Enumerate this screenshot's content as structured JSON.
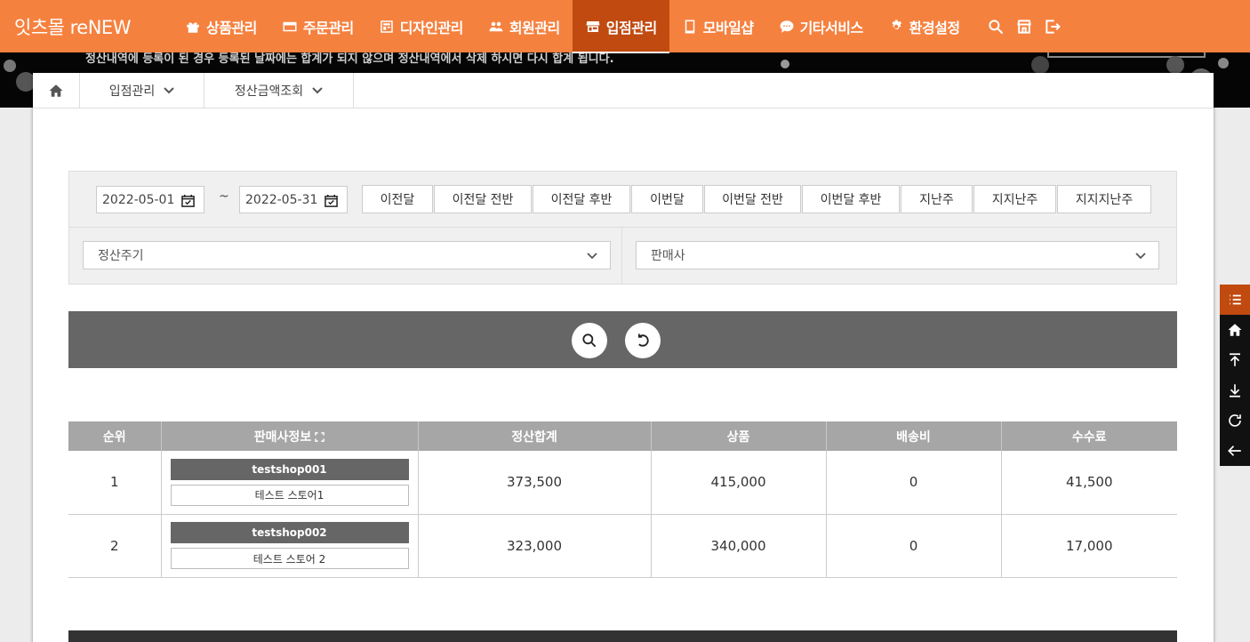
{
  "brand": "잇츠몰 reNEW",
  "nav": [
    {
      "label": "상품관리",
      "icon": "gift-icon"
    },
    {
      "label": "주문관리",
      "icon": "card-icon"
    },
    {
      "label": "디자인관리",
      "icon": "layout-icon"
    },
    {
      "label": "회원관리",
      "icon": "users-icon"
    },
    {
      "label": "입점관리",
      "icon": "store-icon",
      "active": true
    },
    {
      "label": "모바일샵",
      "icon": "tablet-icon"
    },
    {
      "label": "기타서비스",
      "icon": "chat-icon"
    },
    {
      "label": "환경설정",
      "icon": "gear-icon"
    }
  ],
  "notice_text": "정산내역에 등록이 된 경우 등록된 날짜에는 합계가 되지 않으며 정산내역에서 삭제 하시면 다시 합계 됩니다.",
  "breadcrumb": {
    "level1": "입점관리",
    "level2": "정산금액조회"
  },
  "filter": {
    "date_from": "2022-05-01",
    "date_to": "2022-05-31",
    "tilde": "~",
    "quick": [
      "이전달",
      "이전달 전반",
      "이전달 후반",
      "이번달",
      "이번달 전반",
      "이번달 후반",
      "지난주",
      "지지난주",
      "지지지난주"
    ],
    "cycle_select": "정산주기",
    "seller_select": "판매사"
  },
  "table": {
    "headers": [
      "순위",
      "판매사정보",
      "정산합계",
      "상품",
      "배송비",
      "수수료"
    ],
    "rows": [
      {
        "rank": "1",
        "seller_id": "testshop001",
        "seller_name": "테스트 스토어1",
        "total": "373,500",
        "product": "415,000",
        "shipping": "0",
        "fee": "41,500"
      },
      {
        "rank": "2",
        "seller_id": "testshop002",
        "seller_name": "테스트 스토어 2",
        "total": "323,000",
        "product": "340,000",
        "shipping": "0",
        "fee": "17,000"
      }
    ]
  }
}
